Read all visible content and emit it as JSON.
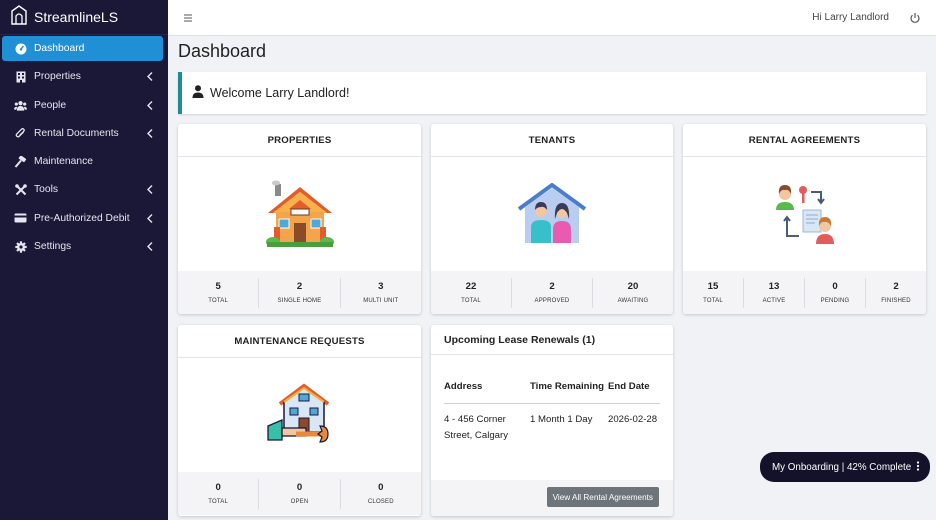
{
  "brand": {
    "name": "StreamlineLS"
  },
  "sidebar": {
    "items": [
      {
        "label": "Dashboard",
        "icon": "dashboard-icon",
        "active": true,
        "expandable": false
      },
      {
        "label": "Properties",
        "icon": "building-icon",
        "active": false,
        "expandable": true
      },
      {
        "label": "People",
        "icon": "users-icon",
        "active": false,
        "expandable": true
      },
      {
        "label": "Rental Documents",
        "icon": "paperclip-icon",
        "active": false,
        "expandable": true
      },
      {
        "label": "Maintenance",
        "icon": "hammer-icon",
        "active": false,
        "expandable": false
      },
      {
        "label": "Tools",
        "icon": "tools-icon",
        "active": false,
        "expandable": true
      },
      {
        "label": "Pre-Authorized Debit",
        "icon": "credit-card-icon",
        "active": false,
        "expandable": true
      },
      {
        "label": "Settings",
        "icon": "gear-icon",
        "active": false,
        "expandable": true
      }
    ]
  },
  "topbar": {
    "greeting": "Hi Larry Landlord"
  },
  "page": {
    "title": "Dashboard",
    "welcome": "Welcome Larry Landlord!"
  },
  "cards": {
    "properties": {
      "title": "PROPERTIES",
      "stats": [
        {
          "value": "5",
          "label": "TOTAL"
        },
        {
          "value": "2",
          "label": "SINGLE HOME"
        },
        {
          "value": "3",
          "label": "MULTI UNIT"
        }
      ]
    },
    "tenants": {
      "title": "TENANTS",
      "stats": [
        {
          "value": "22",
          "label": "TOTAL"
        },
        {
          "value": "2",
          "label": "APPROVED"
        },
        {
          "value": "20",
          "label": "AWAITING"
        }
      ]
    },
    "agreements": {
      "title": "RENTAL AGREEMENTS",
      "stats": [
        {
          "value": "15",
          "label": "TOTAL"
        },
        {
          "value": "13",
          "label": "ACTIVE"
        },
        {
          "value": "0",
          "label": "PENDING"
        },
        {
          "value": "2",
          "label": "FINISHED"
        }
      ]
    },
    "maintenance": {
      "title": "MAINTENANCE REQUESTS",
      "stats": [
        {
          "value": "0",
          "label": "TOTAL"
        },
        {
          "value": "0",
          "label": "OPEN"
        },
        {
          "value": "0",
          "label": "CLOSED"
        }
      ]
    }
  },
  "lease": {
    "title": "Upcoming Lease Renewals (1)",
    "headers": {
      "address": "Address",
      "time": "Time Remaining",
      "end": "End Date"
    },
    "rows": [
      {
        "address": "4 - 456 Corner Street, Calgary",
        "time": "1 Month 1 Day",
        "end": "2026-02-28"
      }
    ],
    "button": "View All Rental Agreements"
  },
  "onboarding": {
    "label": "My Onboarding | 42% Complete"
  },
  "colors": {
    "sidebar": "#1b1737",
    "active": "#1f8fd6",
    "accent": "#1a8d96"
  }
}
